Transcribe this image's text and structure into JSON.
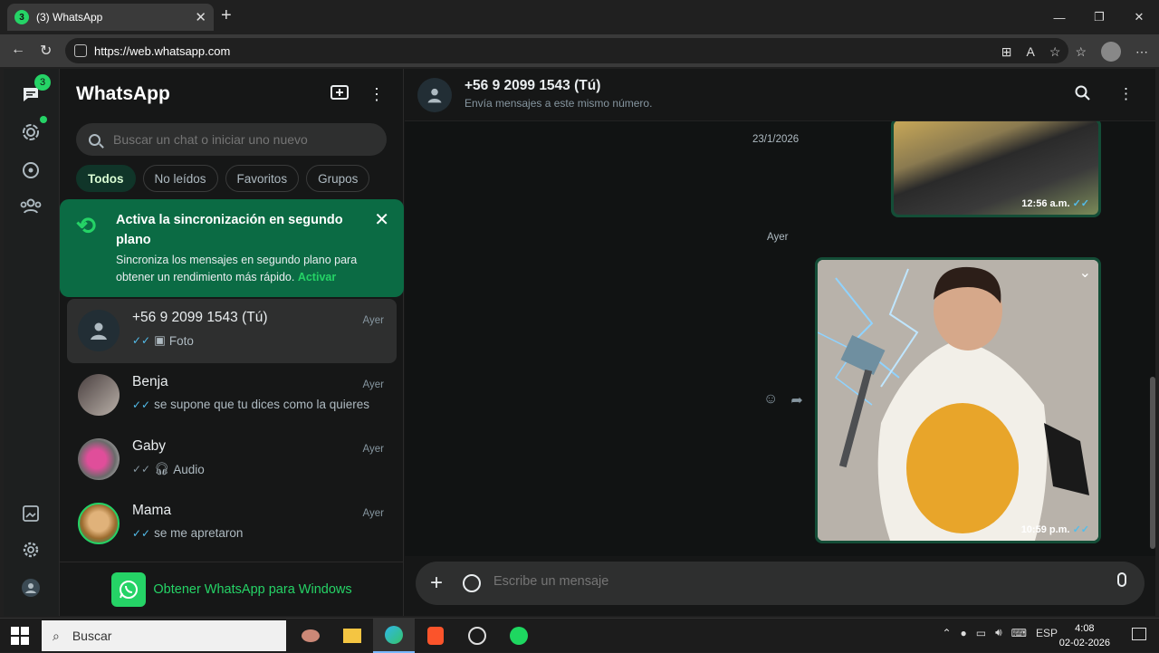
{
  "browser": {
    "tab_title": "(3) WhatsApp",
    "tab_badge": "3",
    "url": "https://web.whatsapp.com"
  },
  "rail": {
    "chats_badge": "3"
  },
  "sidebar": {
    "title": "WhatsApp",
    "search_placeholder": "Buscar un chat o iniciar uno nuevo",
    "filters": [
      "Todos",
      "No leídos",
      "Favoritos",
      "Grupos"
    ],
    "banner": {
      "title": "Activa la sincronización en segundo plano",
      "text": "Sincroniza los mensajes en segundo plano para obtener un rendimiento más rápido.",
      "link": "Activar"
    },
    "chats": [
      {
        "name": "+56 9 2099 1543 (Tú)",
        "time": "Ayer",
        "preview": "Foto",
        "tick": "✓✓",
        "tick_color": "#53bdeb"
      },
      {
        "name": "Benja",
        "time": "Ayer",
        "preview": "se supone que tu dices como la quieres",
        "tick": "✓✓",
        "tick_color": "#53bdeb"
      },
      {
        "name": "Gaby",
        "time": "Ayer",
        "preview": "Audio",
        "tick": "✓✓",
        "tick_color": "#8696a0"
      },
      {
        "name": "Mama",
        "time": "Ayer",
        "preview": "se me apretaron",
        "tick": "✓✓",
        "tick_color": "#53bdeb"
      }
    ],
    "get_app": "Obtener WhatsApp para Windows"
  },
  "chat": {
    "name": "+56 9 2099 1543 (Tú)",
    "subtitle": "Envía mensajes a este mismo número.",
    "date1": "23/1/2026",
    "msg1_time": "12:56 a.m.",
    "date2": "Ayer",
    "msg2_time": "10:59 p.m.",
    "composer_placeholder": "Escribe un mensaje"
  },
  "taskbar": {
    "search": "Buscar",
    "lang": "ESP",
    "time": "4:08",
    "date": "02-02-2026"
  },
  "colors": {
    "accent": "#25d366",
    "banner": "#0b6b44",
    "bubble": "#144d37",
    "read_tick": "#53bdeb"
  }
}
